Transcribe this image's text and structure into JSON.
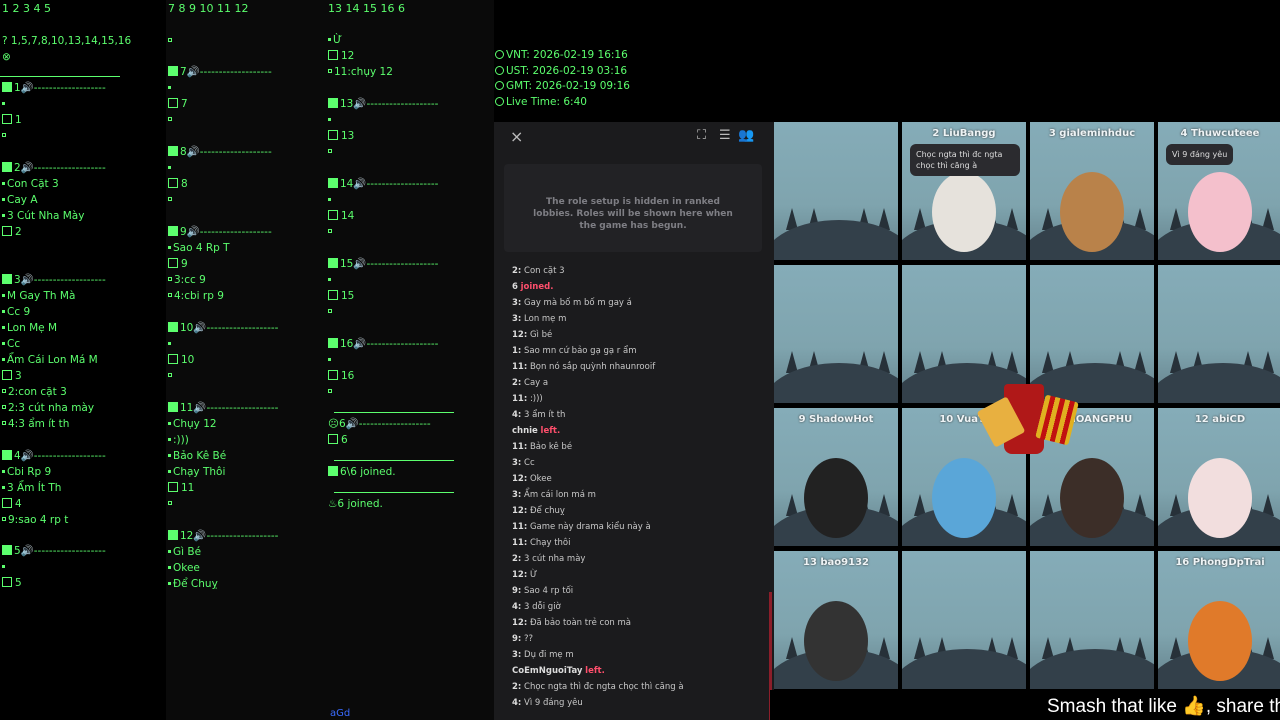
{
  "columns": {
    "col1": {
      "header": "1 2 3 4 5",
      "alive_list": "1,5,7,8,10,13,14,15,16",
      "players": [
        {
          "num": "1",
          "slot": "1",
          "lines": []
        },
        {
          "num": "2",
          "slot": "2",
          "lines": [
            "Con Cặt 3",
            "Cay A",
            "3 Cút Nha Mày"
          ]
        },
        {
          "num": "3",
          "slot": "3",
          "lines": [
            "M Gay Th Mà",
            "Cc 9",
            "Lon Mẹ M",
            "Cc",
            "Ẩm Cái Lon Má M"
          ],
          "notes": [
            "2:con cặt 3",
            "2:3 cút nha mày",
            "4:3 ẩm ít th"
          ]
        },
        {
          "num": "4",
          "slot": "4",
          "lines": [
            "Cbi Rp 9",
            "3 Ẩm Ít Th"
          ],
          "notes": [
            "9:sao 4 rp t"
          ]
        },
        {
          "num": "5",
          "slot": "5",
          "lines": []
        }
      ]
    },
    "col2": {
      "header": "7 8 9 10 11 12",
      "players": [
        {
          "num": "7",
          "slot": "7",
          "lines": []
        },
        {
          "num": "8",
          "slot": "8",
          "lines": []
        },
        {
          "num": "9",
          "slot": "9",
          "lines": [
            "Sao 4 Rp T"
          ],
          "notes": [
            "3:cc 9",
            "4:cbi rp 9"
          ]
        },
        {
          "num": "10",
          "slot": "10",
          "lines": []
        },
        {
          "num": "11",
          "slot": "11",
          "lines": [
            "Chụy 12",
            ":)))",
            "Bảo Kê Bé",
            "Chạy Thôi"
          ]
        },
        {
          "num": "12",
          "slot": "",
          "lines": [
            "Gì Bé",
            "Okee",
            "Để Chuỵ"
          ]
        }
      ]
    },
    "col3": {
      "header": "13 14 15 16 6",
      "top_lines": [
        "Ừ",
        "12",
        "11:chụy 12"
      ],
      "players": [
        {
          "num": "13",
          "slot": "13"
        },
        {
          "num": "14",
          "slot": "14"
        },
        {
          "num": "15",
          "slot": "15"
        },
        {
          "num": "16",
          "slot": "16"
        },
        {
          "num": "6",
          "slot": "6"
        }
      ],
      "joined_a": "6\\6 joined.",
      "joined_b": "6 joined.",
      "corner_text": "aGd"
    },
    "dashes": "-------------------"
  },
  "time": {
    "vnt": "VNT: 2026-02-19 16:16",
    "ust": "UST: 2026-02-19 03:16",
    "gmt": "GMT: 2026-02-19 09:16",
    "live": "Live Time: 6:40"
  },
  "panel": {
    "close": "×",
    "roles_notice": "The role setup is hidden in ranked lobbies. Roles will be shown here when the game has begun.",
    "chat": [
      {
        "who": "2:",
        "text": "Con cặt 3"
      },
      {
        "who": "6",
        "sys": "joined."
      },
      {
        "who": "3:",
        "text": "Gay mà bố m bố m gay á"
      },
      {
        "who": "3:",
        "text": "Lon mẹ m"
      },
      {
        "who": "12:",
        "text": "Gì bé"
      },
      {
        "who": "1:",
        "text": "Sao mn cứ bảo gạ gạ r ẩm"
      },
      {
        "who": "11:",
        "text": "Bọn nó sắp quỳnh nhaunrooif"
      },
      {
        "who": "2:",
        "text": "Cay a"
      },
      {
        "who": "11:",
        "text": ":)))"
      },
      {
        "who": "4:",
        "text": "3 ẩm ít th"
      },
      {
        "who": "chnie",
        "sys": "left."
      },
      {
        "who": "11:",
        "text": "Bảo kê bé"
      },
      {
        "who": "3:",
        "text": "Cc"
      },
      {
        "who": "12:",
        "text": "Okee"
      },
      {
        "who": "3:",
        "text": "Ẩm cái lon má m"
      },
      {
        "who": "12:",
        "text": "Để chuỵ"
      },
      {
        "who": "11:",
        "text": "Game này drama kiểu này à"
      },
      {
        "who": "11:",
        "text": "Chạy thôi"
      },
      {
        "who": "2:",
        "text": "3 cút nha mày"
      },
      {
        "who": "12:",
        "text": "Ừ"
      },
      {
        "who": "9:",
        "text": "Sao 4 rp tối"
      },
      {
        "who": "4:",
        "text": "3 dỗi giờ"
      },
      {
        "who": "12:",
        "text": "Đã bảo toàn trẻ con mà"
      },
      {
        "who": "9:",
        "text": "??"
      },
      {
        "who": "3:",
        "text": "Dụ đi mẹ m"
      },
      {
        "who": "CoEmNguoiTay",
        "sys": "left."
      },
      {
        "who": "2:",
        "text": "Chọc ngta thì đc ngta chọc thì căng à"
      },
      {
        "who": "4:",
        "text": "Vì 9 đáng yêu"
      }
    ]
  },
  "grid": {
    "players": [
      {
        "name": ""
      },
      {
        "name": "2 LiuBangg",
        "bubble": "Chọc ngta thì đc ngta chọc thì căng à"
      },
      {
        "name": "3 gialeminhduc"
      },
      {
        "name": "4 Thuwcuteee",
        "bubble": "Vì 9 đáng yêu"
      },
      {
        "name": ""
      },
      {
        "name": ""
      },
      {
        "name": ""
      },
      {
        "name": ""
      },
      {
        "name": "9 ShadowHot"
      },
      {
        "name": "10 VuaTr"
      },
      {
        "name": "VUHOANGPHU"
      },
      {
        "name": "12 abiCD"
      },
      {
        "name": "13 bao9132"
      },
      {
        "name": ""
      },
      {
        "name": ""
      },
      {
        "name": "16 PhongDpTrai"
      }
    ]
  },
  "footer": {
    "smash": "Smash that like 👍, share the"
  },
  "colors": {
    "log_green": "#5cff6e",
    "sys_red": "#ff4f6c",
    "panel_bg": "#1b1b1d"
  }
}
